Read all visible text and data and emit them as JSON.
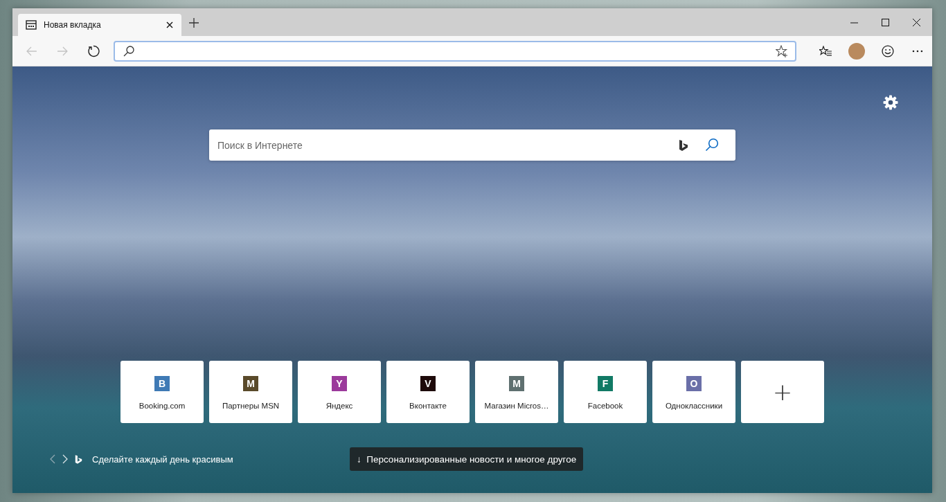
{
  "tab": {
    "title": "Новая вкладка"
  },
  "search": {
    "placeholder": "Поиск в Интернете"
  },
  "tiles": [
    {
      "letter": "B",
      "label": "Booking.com",
      "color": "#3f7ab5"
    },
    {
      "letter": "M",
      "label": "Партнеры MSN",
      "color": "#5a4a2a"
    },
    {
      "letter": "Y",
      "label": "Яндекс",
      "color": "#9b3a9b"
    },
    {
      "letter": "V",
      "label": "Вконтакте",
      "color": "#1e0a0a"
    },
    {
      "letter": "M",
      "label": "Магазин Micros…",
      "color": "#5f7070"
    },
    {
      "letter": "F",
      "label": "Facebook",
      "color": "#117a65"
    },
    {
      "letter": "O",
      "label": "Одноклассники",
      "color": "#6a6fa8"
    }
  ],
  "add_tile": {
    "symbol": "+"
  },
  "image_caption": "Сделайте каждый день красивым",
  "news_button": {
    "arrow": "↓",
    "label": "Персонализированные новости и многое другое"
  }
}
